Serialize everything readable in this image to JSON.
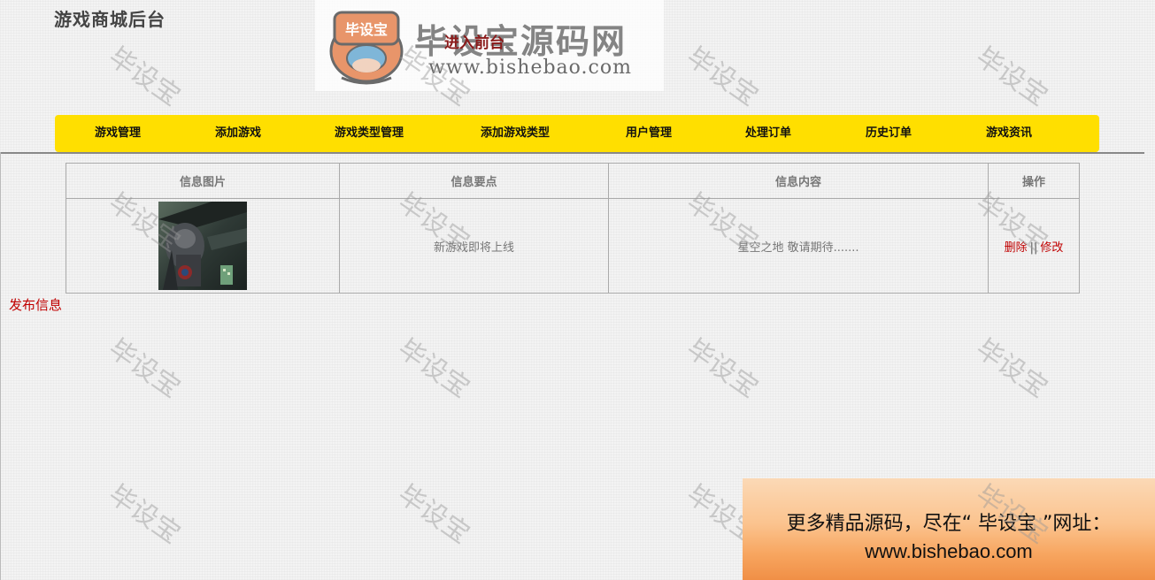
{
  "header": {
    "site_title": "游戏商城后台",
    "front_link": "进入前台"
  },
  "logo": {
    "badge_text": "毕设宝",
    "title": "毕设宝源码网",
    "url": "www.bishebao.com"
  },
  "nav": {
    "items": [
      {
        "label": "游戏管理"
      },
      {
        "label": "添加游戏"
      },
      {
        "label": "游戏类型管理"
      },
      {
        "label": "添加游戏类型"
      },
      {
        "label": "用户管理"
      },
      {
        "label": "处理订单"
      },
      {
        "label": "历史订单"
      },
      {
        "label": "游戏资讯"
      }
    ]
  },
  "table": {
    "headers": [
      "信息图片",
      "信息要点",
      "信息内容",
      "操作"
    ],
    "rows": [
      {
        "image": "game-thumbnail",
        "point": "新游戏即将上线",
        "content": "星空之地 敬请期待.......",
        "delete_label": "删除",
        "separator": "||",
        "edit_label": "修改"
      }
    ]
  },
  "publish_link": "发布信息",
  "watermark": {
    "text": "毕设宝"
  },
  "promo": {
    "line1": "更多精品源码，尽在“ 毕设宝 ”网址：",
    "line2": "www.bishebao.com"
  },
  "colors": {
    "nav_bg": "#ffdf00",
    "link_red": "#c00000",
    "front_link": "#8b1a1a"
  }
}
